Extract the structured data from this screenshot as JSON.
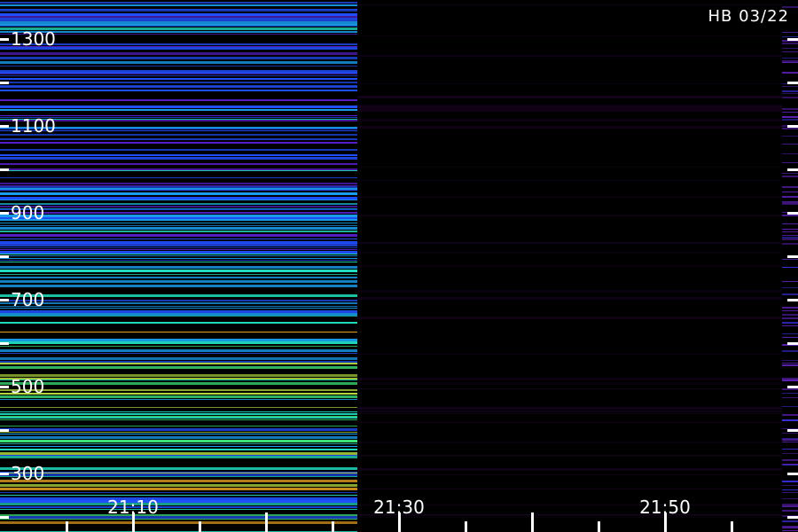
{
  "chart_data": {
    "type": "heatmap",
    "title": "HB 03/22",
    "xlabel": "",
    "ylabel": "",
    "x_tick_labels": [
      "21:10",
      "21:30",
      "21:50"
    ],
    "y_tick_labels": [
      "1300",
      "1100",
      "900",
      "700",
      "500",
      "300"
    ],
    "y_range": [
      200,
      1400
    ],
    "x_range": [
      "21:00",
      "22:00"
    ],
    "data_region_end_time": "21:27",
    "right_edge_strip": "sparse violet lines",
    "colormap": [
      "#000000",
      "#3a0f66",
      "#5a1fd0",
      "#2050ff",
      "#1aa8ff",
      "#20e0c0",
      "#40f080",
      "#b8e040",
      "#e8a020"
    ],
    "grid": false,
    "legend": "none"
  }
}
